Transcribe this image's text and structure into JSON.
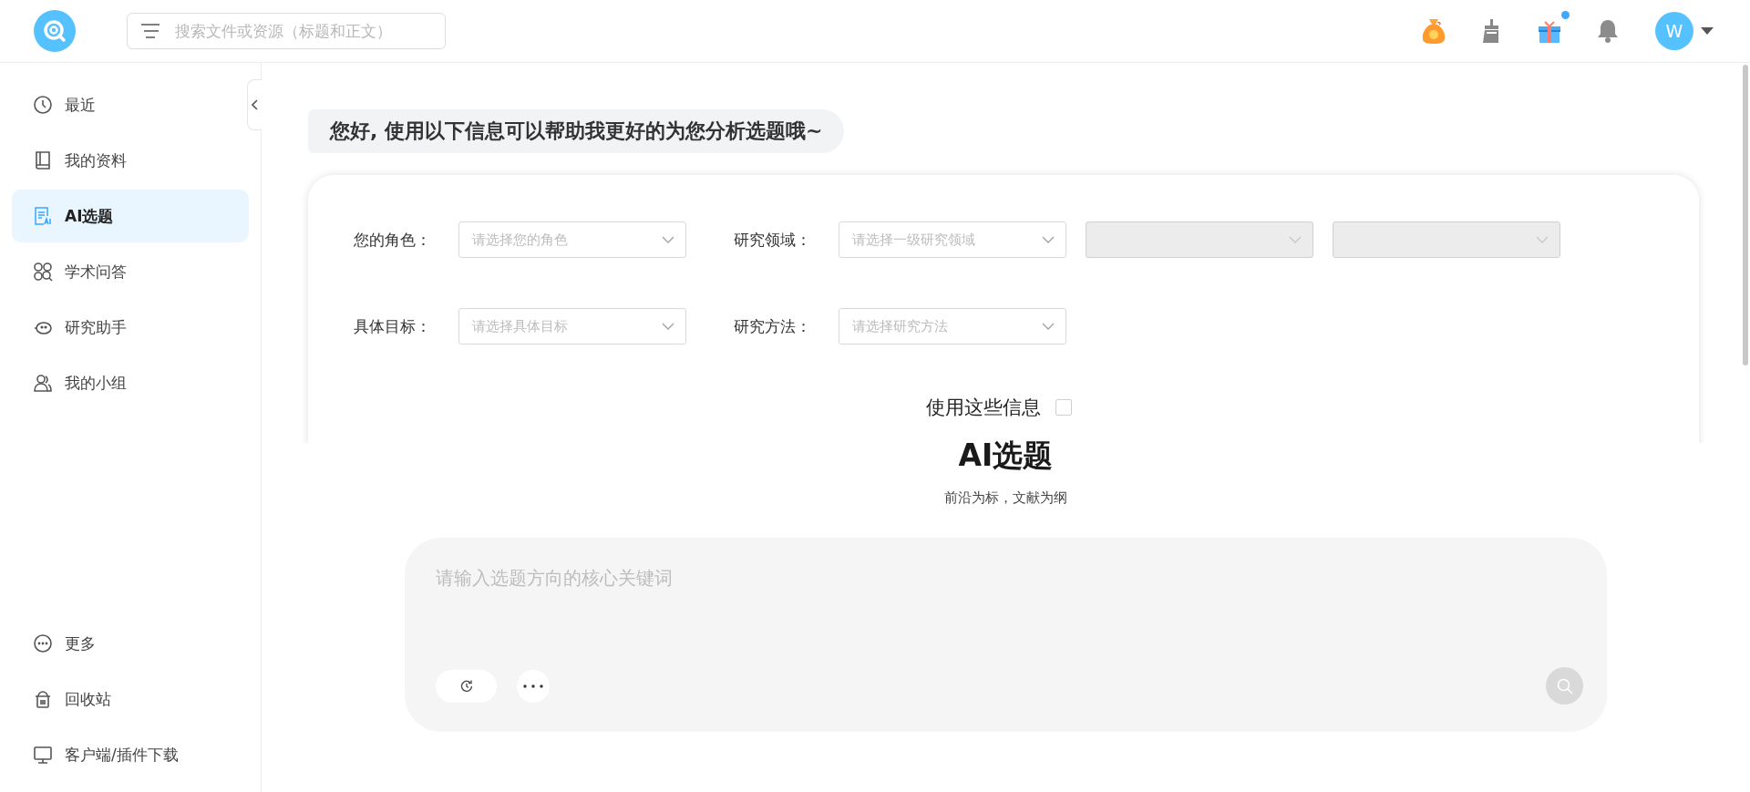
{
  "header": {
    "search": {
      "placeholder": "搜索文件或资源（标题和正文）"
    },
    "actions": [
      {
        "kind": "moneybag"
      },
      {
        "kind": "broom"
      },
      {
        "kind": "gift",
        "dot": true
      },
      {
        "kind": "bell"
      }
    ],
    "avatar": {
      "letter": "W"
    }
  },
  "sidebar": {
    "items": [
      {
        "kind": "clock",
        "label": "最近",
        "selected": false
      },
      {
        "kind": "book",
        "label": "我的资料",
        "selected": false
      },
      {
        "kind": "ai",
        "label": "AI选题",
        "selected": true
      },
      {
        "kind": "grid",
        "label": "学术问答",
        "selected": false
      },
      {
        "kind": "bot",
        "label": "研究助手",
        "selected": false
      },
      {
        "kind": "group",
        "label": "我的小组",
        "selected": false
      }
    ],
    "bottom_items": [
      {
        "kind": "more",
        "label": "更多"
      },
      {
        "kind": "trash",
        "label": "回收站"
      },
      {
        "kind": "monitor",
        "label": "客户端/插件下载"
      }
    ]
  },
  "greeting": "您好, 使用以下信息可以帮助我更好的为您分析选题哦~",
  "form": {
    "rows": [
      {
        "fields": [
          {
            "label": "您的角色：",
            "selects": [
              {
                "placeholder": "请选择您的角色",
                "disabled": false
              }
            ]
          },
          {
            "label": "研究领域：",
            "selects": [
              {
                "placeholder": "请选择一级研究领域",
                "disabled": false
              },
              {
                "disabled": true
              },
              {
                "disabled": true
              }
            ]
          }
        ]
      },
      {
        "fields": [
          {
            "label": "具体目标：",
            "selects": [
              {
                "placeholder": "请选择具体目标",
                "disabled": false
              }
            ]
          },
          {
            "label": "研究方法：",
            "selects": [
              {
                "placeholder": "请选择研究方法",
                "disabled": false
              }
            ]
          }
        ]
      }
    ],
    "use_info": {
      "label": "使用这些信息",
      "checked": false
    }
  },
  "hero": {
    "title": "AI选题",
    "subtitle": "前沿为标，文献为纲"
  },
  "query": {
    "placeholder": "请输入选题方向的核心关键词"
  }
}
